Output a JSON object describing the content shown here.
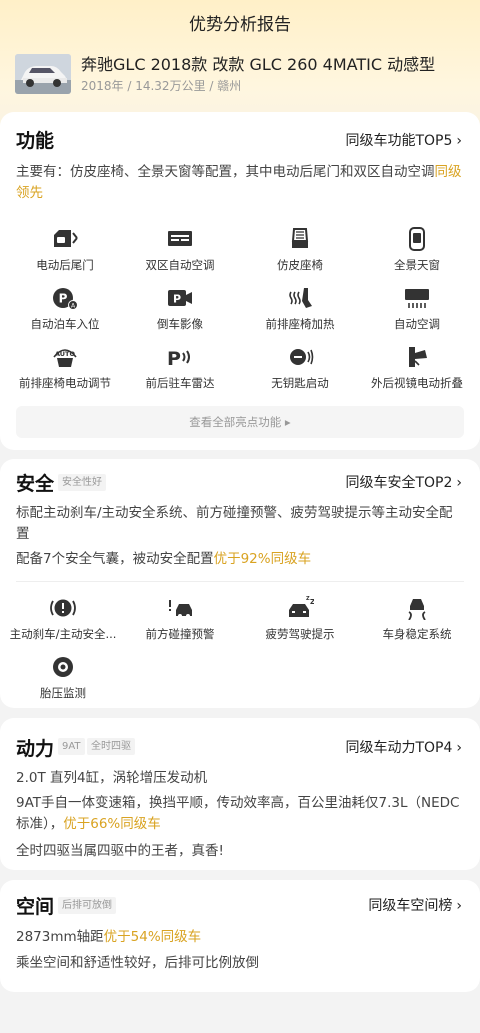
{
  "header": {
    "title": "优势分析报告",
    "car_name": "奔驰GLC 2018款 改款 GLC 260 4MATIC 动感型",
    "car_meta": "2018年 / 14.32万公里 / 赣州"
  },
  "function": {
    "title": "功能",
    "rank_label": "同级车功能TOP5",
    "summary_prefix": "主要有：仿皮座椅、全景天窗等配置，其中电动后尾门和双区自动空调",
    "summary_highlight": "同级领先",
    "features": [
      {
        "label": "电动后尾门",
        "icon": "tailgate-icon"
      },
      {
        "label": "双区自动空调",
        "icon": "dual-ac-icon"
      },
      {
        "label": "仿皮座椅",
        "icon": "leather-seat-icon"
      },
      {
        "label": "全景天窗",
        "icon": "sunroof-icon"
      },
      {
        "label": "自动泊车入位",
        "icon": "auto-park-icon"
      },
      {
        "label": "倒车影像",
        "icon": "reverse-camera-icon"
      },
      {
        "label": "前排座椅加热",
        "icon": "seat-heating-icon"
      },
      {
        "label": "自动空调",
        "icon": "auto-ac-icon"
      },
      {
        "label": "前排座椅电动调节",
        "icon": "seat-adjust-icon"
      },
      {
        "label": "前后驻车雷达",
        "icon": "parking-radar-icon"
      },
      {
        "label": "无钥匙启动",
        "icon": "keyless-start-icon"
      },
      {
        "label": "外后视镜电动折叠",
        "icon": "mirror-fold-icon"
      }
    ],
    "view_all_label": "查看全部亮点功能 ▸"
  },
  "safety": {
    "title": "安全",
    "tag": "安全性好",
    "rank_label": "同级车安全TOP2",
    "active_text": "标配主动刹车/主动安全系统、前方碰撞预警、疲劳驾驶提示等主动安全配置",
    "passive_prefix": "配备7个安全气囊，被动安全配置",
    "passive_highlight": "优于92%同级车",
    "features": [
      {
        "label": "主动刹车/主动安全...",
        "icon": "active-brake-icon"
      },
      {
        "label": "前方碰撞预警",
        "icon": "collision-warning-icon"
      },
      {
        "label": "疲劳驾驶提示",
        "icon": "fatigue-alert-icon"
      },
      {
        "label": "车身稳定系统",
        "icon": "stability-control-icon"
      },
      {
        "label": "胎压监测",
        "icon": "tire-pressure-icon"
      }
    ]
  },
  "power": {
    "title": "动力",
    "tags": [
      "9AT",
      "全时四驱"
    ],
    "rank_label": "同级车动力TOP4",
    "line1": "2.0T 直列4缸，涡轮增压发动机",
    "line2_prefix": "9AT手自一体变速箱，换挡平顺，传动效率高，百公里油耗仅7.3L（NEDC标准），",
    "line2_highlight": "优于66%同级车",
    "line3": "全时四驱当属四驱中的王者，真香!"
  },
  "space": {
    "title": "空间",
    "tag": "后排可放倒",
    "rank_label": "同级车空间榜",
    "line1_prefix": "2873mm轴距",
    "line1_highlight": "优于54%同级车",
    "line2": "乘坐空间和舒适性较好，后排可比例放倒"
  },
  "colors": {
    "accent": "#d9a322",
    "hero_top": "#fff0c8",
    "icon": "#333333"
  }
}
